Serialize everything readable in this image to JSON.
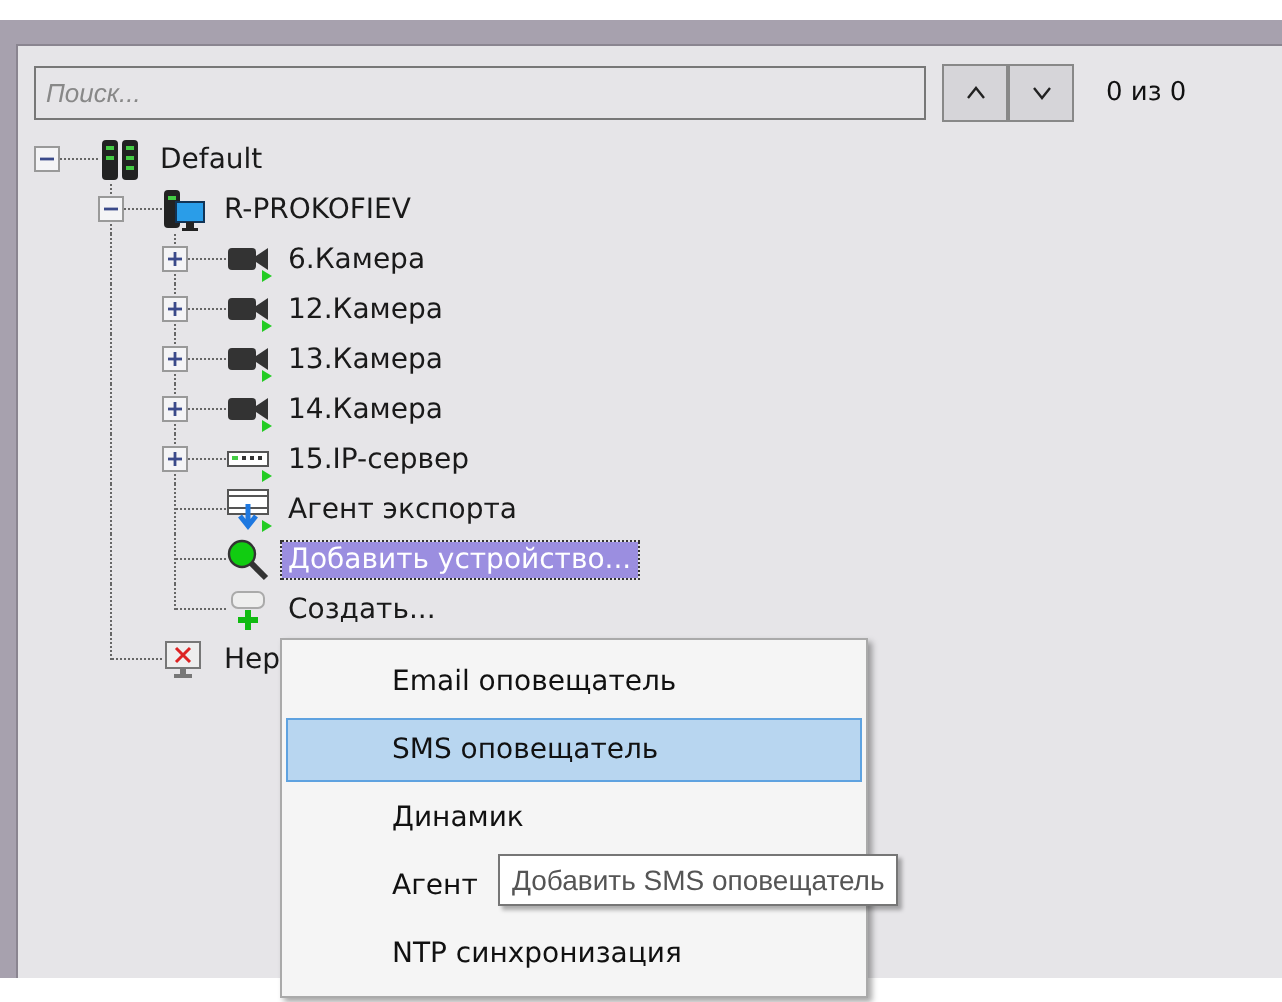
{
  "search": {
    "placeholder": "Поиск...",
    "counter": "0 из 0"
  },
  "nav_buttons": [
    {
      "kind": "up"
    },
    {
      "kind": "down"
    }
  ],
  "tree": [
    {
      "label": "Default",
      "kind": "server",
      "expanded": true,
      "selected": false,
      "children": [
        {
          "label": "R-PROKOFIEV",
          "kind": "computer",
          "expanded": true,
          "selected": false,
          "children": [
            {
              "label": "6.Камера",
              "kind": "camera",
              "expanded": false,
              "selected": false
            },
            {
              "label": "12.Камера",
              "kind": "camera",
              "expanded": false,
              "selected": false
            },
            {
              "label": "13.Камера",
              "kind": "camera",
              "expanded": false,
              "selected": false
            },
            {
              "label": "14.Камера",
              "kind": "camera",
              "expanded": false,
              "selected": false
            },
            {
              "label": "15.IP-сервер",
              "kind": "ip-server",
              "expanded": false,
              "selected": false
            },
            {
              "label": "Агент экспорта",
              "kind": "export-agent",
              "selected": false
            },
            {
              "label": "Добавить устройство...",
              "kind": "search",
              "selected": true
            },
            {
              "label": "Создать...",
              "kind": "create",
              "selected": false
            }
          ]
        },
        {
          "label": "Нер",
          "kind": "monitor-error",
          "selected": false
        }
      ]
    }
  ],
  "context_menu": [
    {
      "label": "Email оповещатель",
      "selected": false
    },
    {
      "label": "SMS оповещатель",
      "selected": true
    },
    {
      "label": "Динамик",
      "selected": false
    },
    {
      "label": "Агент",
      "selected": false
    },
    {
      "label": "NTP синхронизация",
      "selected": false
    }
  ],
  "tooltip": "Добавить SMS оповещатель"
}
